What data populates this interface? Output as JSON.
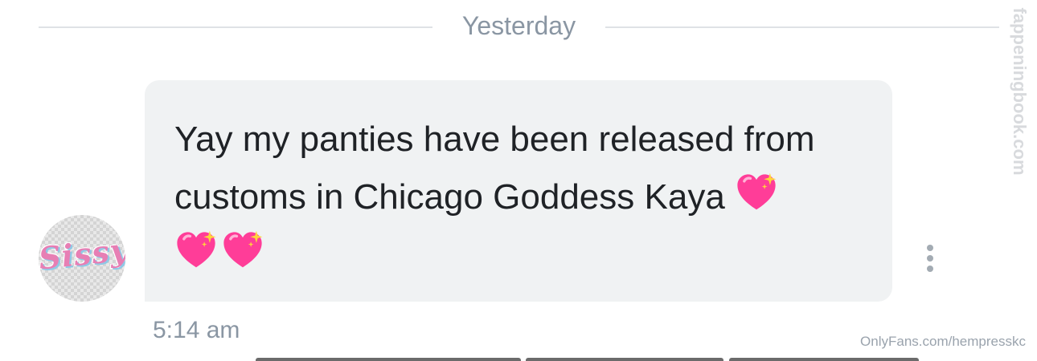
{
  "date_divider": {
    "label": "Yesterday"
  },
  "message": {
    "sender_avatar_text": "Sissy",
    "text_before_emoji": "Yay my panties have been released from customs in Chicago Goddess Kaya ",
    "emoji": [
      "sparkling-heart",
      "sparkling-heart",
      "sparkling-heart"
    ],
    "time": "5:14 am"
  },
  "watermarks": {
    "side": "fappeningbook.com",
    "bottom": "OnlyFans.com/hempresskc"
  },
  "colors": {
    "bubble": "#f0f2f3",
    "text": "#1f2226",
    "muted": "#8a96a3",
    "heart": "#ff2d8e"
  }
}
